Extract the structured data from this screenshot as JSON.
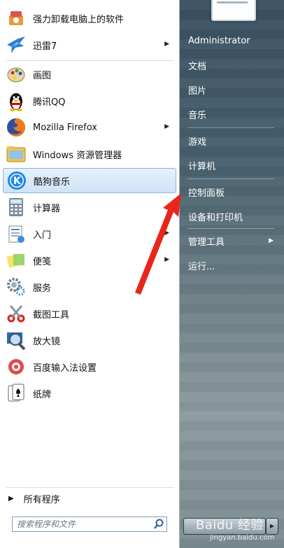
{
  "start_menu": {
    "pinned_items": [
      {
        "label": "强力卸载电脑上的软件",
        "icon": "uninstall-icon",
        "has_submenu": false
      },
      {
        "label": "迅雷7",
        "icon": "thunder-bird-icon",
        "has_submenu": true
      },
      {
        "label": "画图",
        "icon": "paint-palette-icon",
        "has_submenu": false
      },
      {
        "label": "腾讯QQ",
        "icon": "qq-penguin-icon",
        "has_submenu": false
      },
      {
        "label": "Mozilla Firefox",
        "icon": "firefox-icon",
        "has_submenu": true
      },
      {
        "label": "Windows 资源管理器",
        "icon": "folder-explorer-icon",
        "has_submenu": false
      },
      {
        "label": "酷狗音乐",
        "icon": "kugou-icon",
        "has_submenu": false,
        "highlighted": true
      },
      {
        "label": "计算器",
        "icon": "calculator-icon",
        "has_submenu": false
      },
      {
        "label": "入门",
        "icon": "getting-started-icon",
        "has_submenu": true
      },
      {
        "label": "便笺",
        "icon": "sticky-notes-icon",
        "has_submenu": true
      },
      {
        "label": "服务",
        "icon": "services-gear-icon",
        "has_submenu": false
      },
      {
        "label": "截图工具",
        "icon": "scissors-icon",
        "has_submenu": false
      },
      {
        "label": "放大镜",
        "icon": "magnifier-icon",
        "has_submenu": false
      },
      {
        "label": "百度输入法设置",
        "icon": "baidu-ime-settings-icon",
        "has_submenu": false
      },
      {
        "label": "纸牌",
        "icon": "solitaire-cards-icon",
        "has_submenu": false
      }
    ],
    "all_programs": "所有程序",
    "search": {
      "placeholder": "搜索程序和文件"
    },
    "right_items": [
      {
        "label": "Administrator",
        "has_submenu": false
      },
      {
        "label": "文档",
        "has_submenu": false
      },
      {
        "label": "图片",
        "has_submenu": false
      },
      {
        "label": "音乐",
        "has_submenu": false
      },
      {
        "label": "游戏",
        "has_submenu": false
      },
      {
        "label": "计算机",
        "has_submenu": false
      },
      {
        "label": "控制面板",
        "has_submenu": false
      },
      {
        "label": "设备和打印机",
        "has_submenu": false
      },
      {
        "label": "管理工具",
        "has_submenu": true
      },
      {
        "label": "运行...",
        "has_submenu": false
      }
    ],
    "watermark": {
      "main": "Baidu 经验",
      "sub": "jingyan.baidu.com"
    },
    "colors": {
      "highlight_border": "#86b6e3",
      "annotation_arrow": "#e8261c"
    }
  }
}
